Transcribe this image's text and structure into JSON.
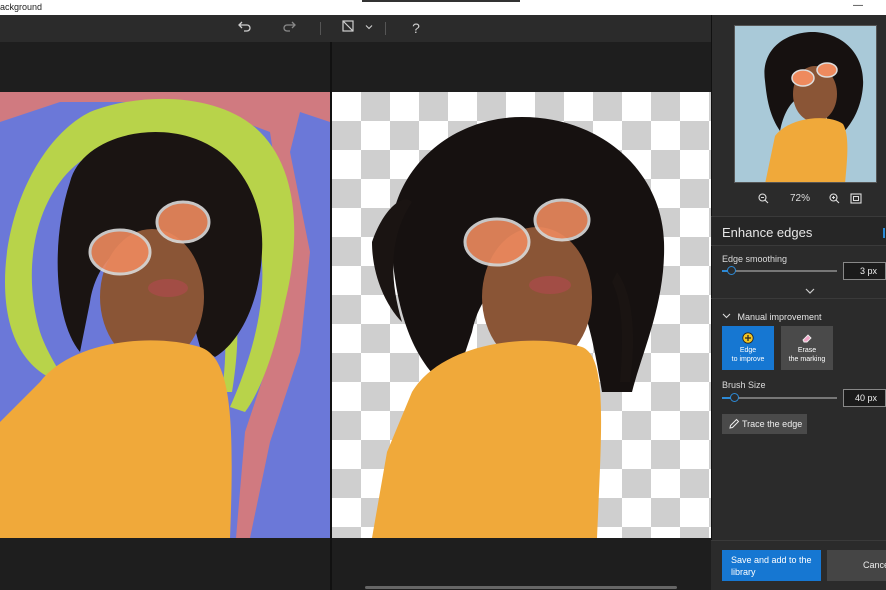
{
  "window": {
    "title": "ackground",
    "minimize_glyph": "—"
  },
  "toolbar": {
    "undo_icon": "undo-icon",
    "redo_icon": "redo-icon",
    "view_icon": "view-compare-icon",
    "help_label": "?"
  },
  "preview": {
    "zoom_label": "72%"
  },
  "enhance": {
    "title": "Enhance edges",
    "edge_smoothing_label": "Edge smoothing",
    "edge_smoothing_value": "3 px",
    "edge_smoothing_level": 0.08
  },
  "manual": {
    "title": "Manual improvement",
    "tool_improve_line1": "Edge",
    "tool_improve_line2": "to improve",
    "tool_erase_line1": "Erase",
    "tool_erase_line2": "the marking",
    "brush_size_label": "Brush Size",
    "brush_size_value": "40 px",
    "brush_size_level": 0.1,
    "trace_label": "Trace the edge"
  },
  "actions": {
    "save_line1": "Save and add to the",
    "save_line2": "library",
    "cancel_label": "Cancel"
  },
  "colors": {
    "accent": "#1677d2",
    "mask_keep": "#b8d34a",
    "mask_remove": "#d07a80",
    "background_fill": "#6b78d8",
    "sweater": "#f0a93a"
  }
}
